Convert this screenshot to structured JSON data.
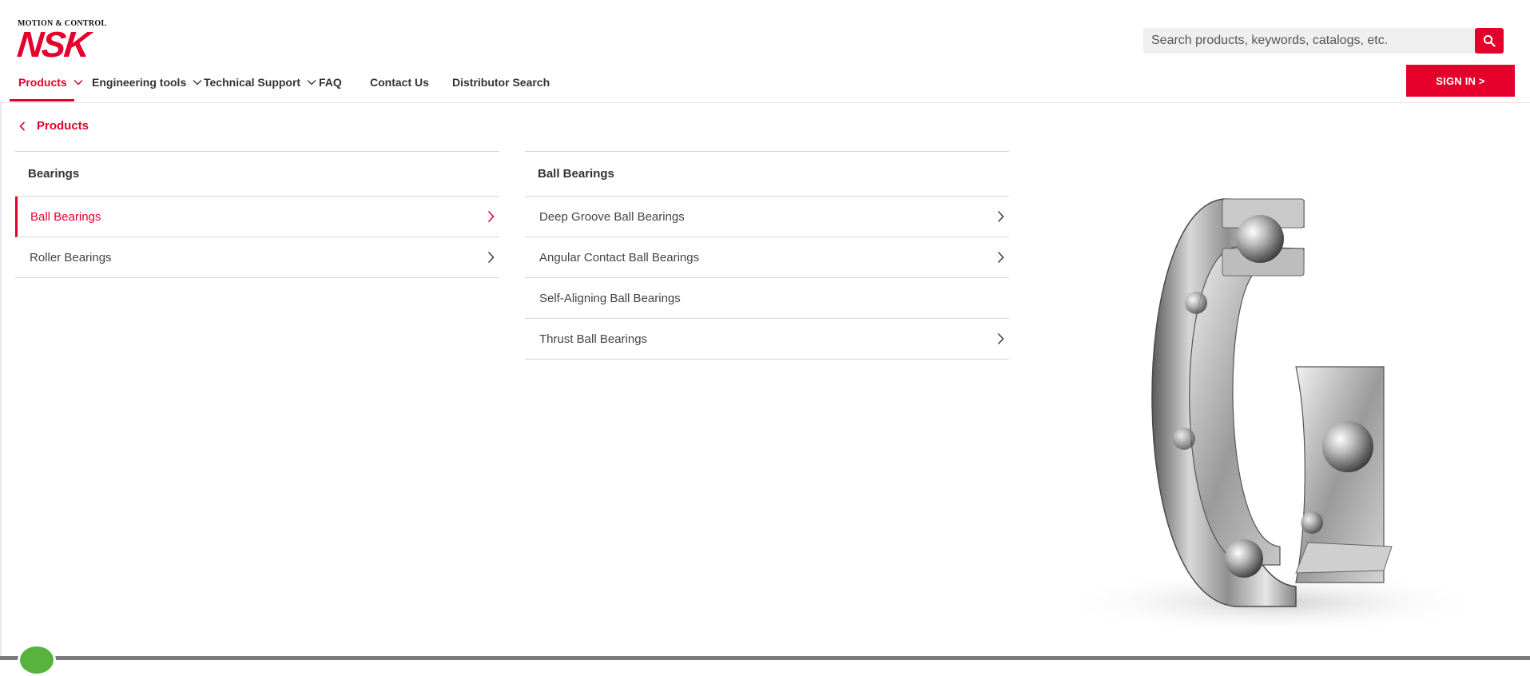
{
  "logo": {
    "tagline": "MOTION & CONTROL",
    "mark": "NSK"
  },
  "search": {
    "placeholder": "Search products, keywords, catalogs, etc."
  },
  "nav": {
    "items": [
      {
        "label": "Products",
        "active": true,
        "dropdown": true
      },
      {
        "label": "Engineering tools",
        "dropdown": true
      },
      {
        "label": "Technical Support",
        "dropdown": true
      },
      {
        "label": "FAQ"
      },
      {
        "label": "Contact Us"
      },
      {
        "label": "Distributor Search"
      }
    ]
  },
  "signin": {
    "label": "SIGN IN >"
  },
  "menu": {
    "back_label": "Products",
    "col1": {
      "title": "Bearings",
      "items": [
        {
          "label": "Ball Bearings",
          "active": true,
          "has_children": true
        },
        {
          "label": "Roller Bearings",
          "has_children": true
        }
      ]
    },
    "col2": {
      "title": "Ball Bearings",
      "items": [
        {
          "label": "Deep Groove Ball Bearings",
          "has_children": true
        },
        {
          "label": "Angular Contact Ball Bearings",
          "has_children": true
        },
        {
          "label": "Self-Aligning Ball Bearings",
          "has_children": false
        },
        {
          "label": "Thrust Ball Bearings",
          "has_children": true
        }
      ]
    }
  },
  "icons": {
    "search": "search-icon",
    "chevron_down": "chevron-down-icon",
    "chevron_right": "chevron-right-icon",
    "chevron_left": "chevron-left-icon"
  },
  "colors": {
    "brand": "#e4002b",
    "text": "#333333",
    "divider": "#d6d6d6"
  }
}
